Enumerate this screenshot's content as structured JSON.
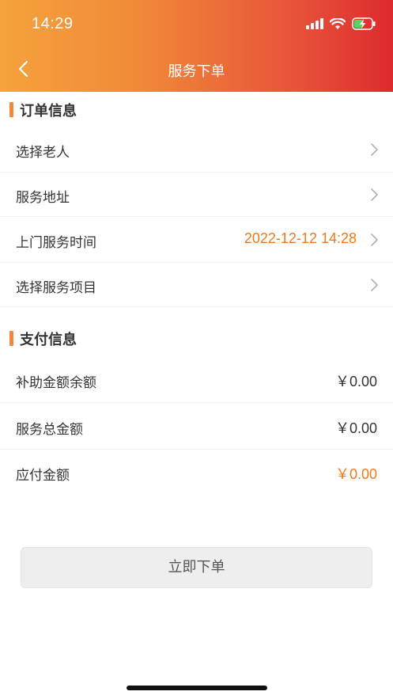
{
  "status_bar": {
    "time": "14:29",
    "icons": [
      "cellular-signal-icon",
      "wifi-icon",
      "battery-charging-icon"
    ]
  },
  "nav": {
    "back_icon": "chevron-left-icon",
    "title": "服务下单"
  },
  "order_info": {
    "title": "订单信息",
    "rows": [
      {
        "label": "选择老人",
        "value": ""
      },
      {
        "label": "服务地址",
        "value": ""
      },
      {
        "label": "上门服务时间",
        "value": "2022-12-12 14:28"
      },
      {
        "label": "选择服务项目",
        "value": ""
      }
    ]
  },
  "payment_info": {
    "title": "支付信息",
    "rows": [
      {
        "label": "补助金额余额",
        "value": "￥0.00"
      },
      {
        "label": "服务总金额",
        "value": "￥0.00"
      },
      {
        "label": "应付金额",
        "value": "￥0.00"
      }
    ]
  },
  "submit": {
    "label": "立即下单"
  },
  "colors": {
    "header_gradient_start": "#f5a23c",
    "header_gradient_end": "#dd2a2e",
    "accent_orange": "#f07a1a",
    "section_bar": "#f08a38",
    "button_bg": "#eeeeee"
  }
}
